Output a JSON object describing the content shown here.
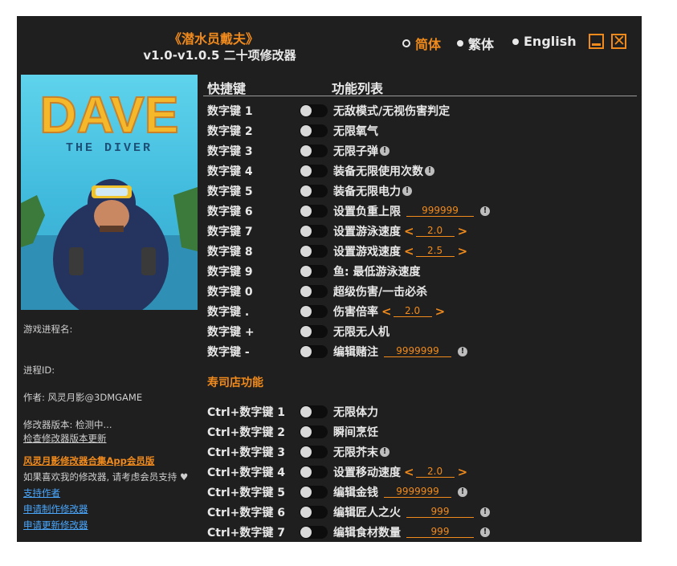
{
  "header": {
    "title": "《潜水员戴夫》",
    "subtitle": "v1.0-v1.0.5 二十项修改器"
  },
  "languages": {
    "simplified": "简体",
    "traditional": "繁体",
    "english": "English"
  },
  "cover": {
    "logo_main": "DAVE",
    "logo_sub": "THE DIVER"
  },
  "sidebar": {
    "process_name": "游戏进程名:",
    "process_id": "进程ID:",
    "author": "作者: 风灵月影@3DMGAME",
    "version": "修改器版本: 检测中...",
    "check_update": "检查修改器版本更新",
    "app_promo": "风灵月影修改器合集App会员版",
    "support_note": "如果喜欢我的修改器, 请考虑会员支持",
    "support_author": "支持作者",
    "request_make": "申请制作修改器",
    "request_update": "申请更新修改器"
  },
  "columns": {
    "hotkey": "快捷键",
    "function": "功能列表"
  },
  "section_sushi": "寿司店功能",
  "cheats": [
    {
      "key": "数字键 1",
      "name": "无敌模式/无视伤害判定"
    },
    {
      "key": "数字键 2",
      "name": "无限氧气"
    },
    {
      "key": "数字键 3",
      "name": "无限子弹"
    },
    {
      "key": "数字键 4",
      "name": "装备无限使用次数"
    },
    {
      "key": "数字键 5",
      "name": "装备无限电力"
    },
    {
      "key": "数字键 6",
      "name": "设置负重上限",
      "value": "999999"
    },
    {
      "key": "数字键 7",
      "name": "设置游泳速度",
      "value": "2.0"
    },
    {
      "key": "数字键 8",
      "name": "设置游戏速度",
      "value": "2.5"
    },
    {
      "key": "数字键 9",
      "name": "鱼: 最低游泳速度"
    },
    {
      "key": "数字键 0",
      "name": "超级伤害/一击必杀"
    },
    {
      "key": "数字键 .",
      "name": "伤害倍率",
      "value": "2.0"
    },
    {
      "key": "数字键 +",
      "name": "无限无人机"
    },
    {
      "key": "数字键 -",
      "name": "编辑赌注",
      "value": "9999999"
    }
  ],
  "sushi_cheats": [
    {
      "key": "Ctrl+数字键 1",
      "name": "无限体力"
    },
    {
      "key": "Ctrl+数字键 2",
      "name": "瞬间烹饪"
    },
    {
      "key": "Ctrl+数字键 3",
      "name": "无限芥末"
    },
    {
      "key": "Ctrl+数字键 4",
      "name": "设置移动速度",
      "value": "2.0"
    },
    {
      "key": "Ctrl+数字键 5",
      "name": "编辑金钱",
      "value": "9999999"
    },
    {
      "key": "Ctrl+数字键 6",
      "name": "编辑匠人之火",
      "value": "999"
    },
    {
      "key": "Ctrl+数字键 7",
      "name": "编辑食材数量",
      "value": "999"
    }
  ],
  "icons": {
    "info": "info-icon",
    "heart": "heart-icon",
    "minimize": "minimize-icon",
    "close": "close-icon"
  },
  "colors": {
    "accent": "#f08a1c",
    "background": "#1f1f1f",
    "link": "#4aa8ff"
  }
}
